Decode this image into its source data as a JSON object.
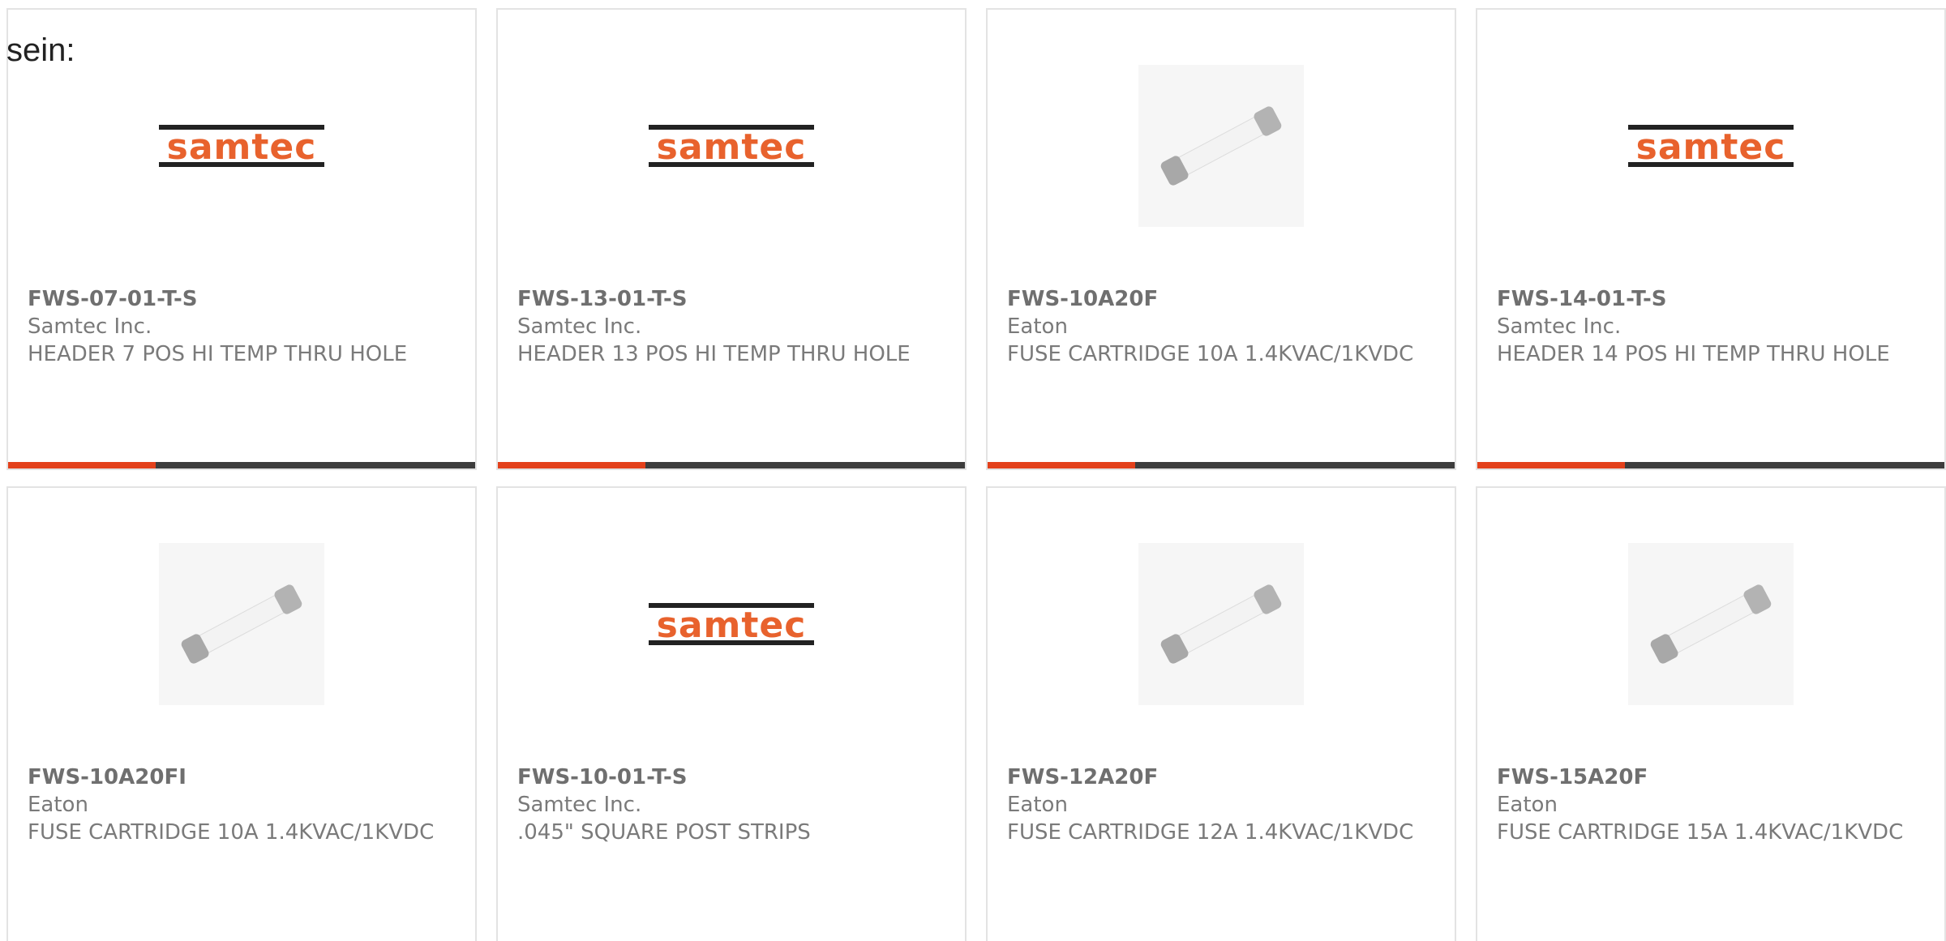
{
  "intro": {
    "text": "sein:"
  },
  "brand": {
    "accent_color": "#e3411c",
    "bar_color": "#3d3d3d",
    "samtec_orange": "#e8622d",
    "samtec_stripe": "#222222"
  },
  "products": [
    {
      "part_number": "FWS-07-01-T-S",
      "manufacturer": "Samtec Inc.",
      "description": "HEADER 7 POS HI TEMP THRU HOLE",
      "image": "samtec-logo"
    },
    {
      "part_number": "FWS-13-01-T-S",
      "manufacturer": "Samtec Inc.",
      "description": "HEADER 13 POS HI TEMP THRU HOLE",
      "image": "samtec-logo"
    },
    {
      "part_number": "FWS-10A20F",
      "manufacturer": "Eaton",
      "description": "FUSE CARTRIDGE 10A 1.4KVAC/1KVDC",
      "image": "fuse-cartridge"
    },
    {
      "part_number": "FWS-14-01-T-S",
      "manufacturer": "Samtec Inc.",
      "description": "HEADER 14 POS HI TEMP THRU HOLE",
      "image": "samtec-logo"
    },
    {
      "part_number": "FWS-10A20FI",
      "manufacturer": "Eaton",
      "description": "FUSE CARTRIDGE 10A 1.4KVAC/1KVDC",
      "image": "fuse-cartridge"
    },
    {
      "part_number": "FWS-10-01-T-S",
      "manufacturer": "Samtec Inc.",
      "description": ".045\" SQUARE POST STRIPS",
      "image": "samtec-logo"
    },
    {
      "part_number": "FWS-12A20F",
      "manufacturer": "Eaton",
      "description": "FUSE CARTRIDGE 12A 1.4KVAC/1KVDC",
      "image": "fuse-cartridge"
    },
    {
      "part_number": "FWS-15A20F",
      "manufacturer": "Eaton",
      "description": "FUSE CARTRIDGE 15A 1.4KVAC/1KVDC",
      "image": "fuse-cartridge"
    }
  ]
}
